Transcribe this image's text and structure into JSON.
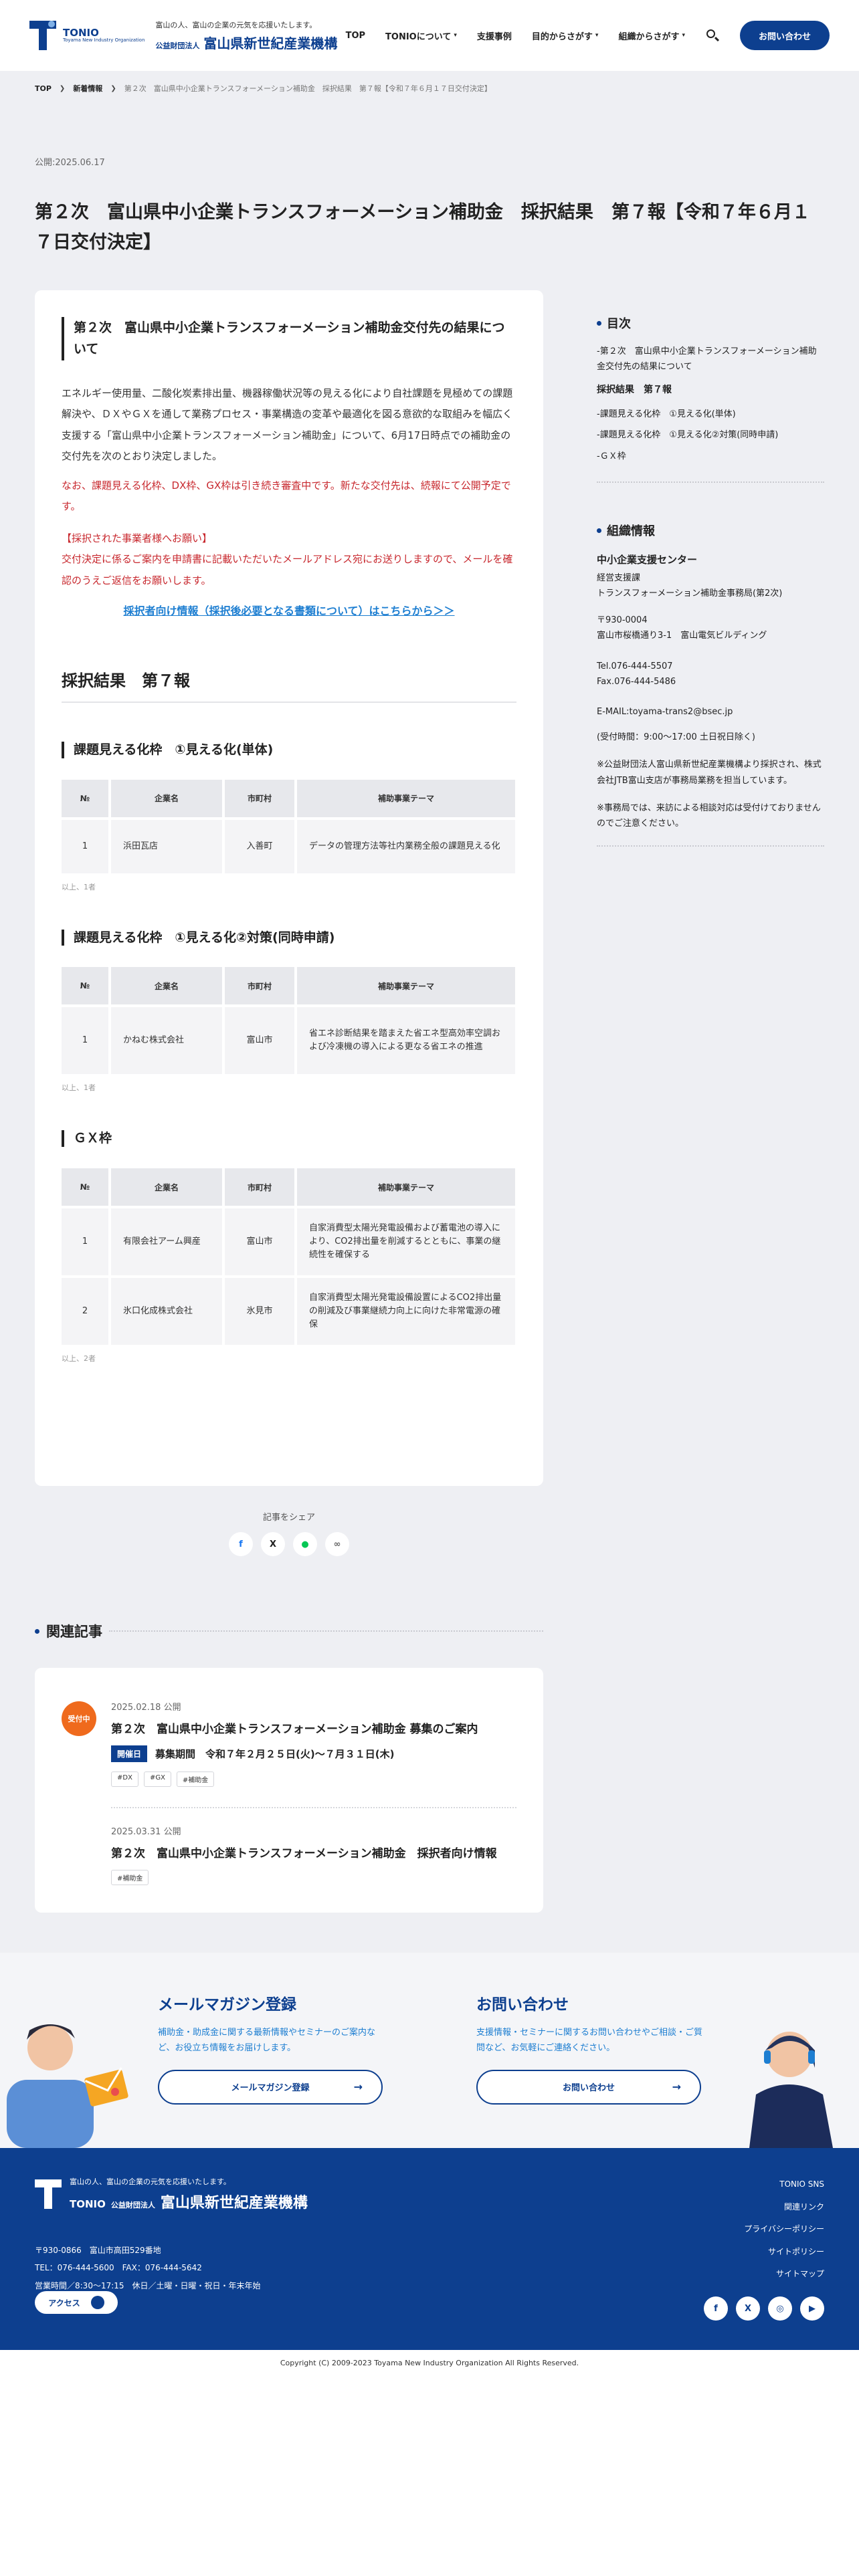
{
  "header": {
    "logo_en": "TONIO",
    "logo_en_sub": "Toyama New Industry Organization",
    "tagline": "富山の人、富山の企業の元気を応援いたします。",
    "org_small": "公益財団法人",
    "org_name": "富山県新世紀産業機構",
    "nav": [
      "TOP",
      "TONIOについて",
      "支援事例",
      "目的からさがす",
      "組織からさがす"
    ],
    "contact_label": "お問い合わせ"
  },
  "breadcrumb": [
    "TOP",
    "新着情報",
    "第２次　富山県中小企業トランスフォーメーション補助金　採択結果　第７報【令和７年６月１７日交付決定】"
  ],
  "post": {
    "date": "公開:2025.06.17",
    "title": "第２次　富山県中小企業トランスフォーメーション補助金　採択結果　第７報【令和７年６月１７日交付決定】"
  },
  "article": {
    "heading": "第２次　富山県中小企業トランスフォーメーション補助金交付先の結果について",
    "lead": "エネルギー使用量、二酸化炭素排出量、機器稼働状況等の見える化により自社課題を見極めての課題解決や、ＤＸやＧＸを通して業務プロセス・事業構造の変革や最適化を図る意欲的な取組みを幅広く支援する「富山県中小企業トランスフォーメーション補助金」について、6月17日時点での補助金の交付先を次のとおり決定しました。",
    "red_note": "なお、課題見える化枠、DX枠、GX枠は引き続き審査中です。新たな交付先は、続報にて公開予定です。",
    "notice_title": "【採択された事業者様へお願い】",
    "notice_body": "交付決定に係るご案内を申請書に記載いただいたメールアドレス宛にお送りしますので、メールを確認のうえご返信をお願いします。",
    "link_text": "採択者向け情報（採択後必要となる書類について）はこちらから＞＞",
    "section_title": "採択結果　第７報",
    "headers": [
      "№",
      "企業名",
      "市町村",
      "補助事業テーマ"
    ],
    "categories": [
      {
        "title": "課題見える化枠　①見える化(単体)",
        "rows": [
          {
            "no": "1",
            "company": "浜田瓦店",
            "city": "入善町",
            "theme": "データの管理方法等社内業務全般の課題見える化"
          }
        ],
        "count": "以上、1者"
      },
      {
        "title": "課題見える化枠　①見える化②対策(同時申請)",
        "rows": [
          {
            "no": "1",
            "company": "かねむ株式会社",
            "city": "富山市",
            "theme": "省エネ診断結果を踏まえた省エネ型高効率空調および冷凍機の導入による更なる省エネの推進"
          }
        ],
        "count": "以上、1者"
      },
      {
        "title": "ＧＸ枠",
        "rows": [
          {
            "no": "1",
            "company": "有限会社アーム興産",
            "city": "富山市",
            "theme": "自家消費型太陽光発電設備および蓄電池の導入により、CO2排出量を削減するとともに、事業の継続性を確保する"
          },
          {
            "no": "2",
            "company": "氷口化成株式会社",
            "city": "氷見市",
            "theme": "自家消費型太陽光発電設備設置によるCO2排出量の削減及び事業継続力向上に向けた非常電源の確保"
          }
        ],
        "count": "以上、2者"
      }
    ]
  },
  "share": {
    "label": "記事をシェア",
    "icons": [
      "facebook-icon",
      "x-icon",
      "line-icon",
      "link-icon"
    ]
  },
  "toc": {
    "title": "目次",
    "items": [
      "-第２次　富山県中小企業トランスフォーメーション補助金交付先の結果について",
      "採択結果　第７報",
      "-課題見える化枠　①見える化(単体)",
      "-課題見える化枠　①見える化②対策(同時申請)",
      "-ＧＸ枠"
    ]
  },
  "org_info": {
    "title": "組織情報",
    "name": "中小企業支援センター",
    "dept": "経営支援課",
    "office": "トランスフォーメーション補助金事務局(第2次)",
    "zip": "〒930-0004",
    "address": "富山市桜橋通り3-1　富山電気ビルディング",
    "tel": "Tel.076-444-5507",
    "fax": "Fax.076-444-5486",
    "email": "E-MAIL:toyama-trans2@bsec.jp",
    "hours": "(受付時間：9:00〜17:00 土日祝日除く)",
    "note1": "※公益財団法人富山県新世紀産業機構より採択され、株式会社JTB富山支店が事務局業務を担当しています。",
    "note2": "※事務局では、来訪による相談対応は受付けておりませんのでご注意ください。"
  },
  "related": {
    "title": "関連記事",
    "badge": "受付中",
    "items": [
      {
        "date": "2025.02.18 公開",
        "title": "第２次　富山県中小企業トランスフォーメーション補助金 募集のご案内",
        "status": "開催日",
        "period": "募集期間　令和７年２月２５日(火)〜７月３１日(木)",
        "tags": [
          "#DX",
          "#GX",
          "#補助金"
        ]
      },
      {
        "date": "2025.03.31 公開",
        "title": "第２次　富山県中小企業トランスフォーメーション補助金　採択者向け情報",
        "tags": [
          "#補助金"
        ]
      }
    ]
  },
  "band": {
    "mail_title": "メールマガジン登録",
    "mail_desc": "補助金・助成金に関する最新情報やセミナーのご案内など、お役立ち情報をお届けします。",
    "mail_btn": "メールマガジン登録",
    "contact_title": "お問い合わせ",
    "contact_desc": "支援情報・セミナーに関するお問い合わせやご相談・ご質問など、お気軽にご連絡ください。",
    "contact_btn": "お問い合わせ"
  },
  "footer": {
    "tagline": "富山の人、富山の企業の元気を応援いたします。",
    "logo_en": "TONIO",
    "org_small": "公益財団法人",
    "org_name": "富山県新世紀産業機構",
    "address": "〒930-0866　富山市高田529番地",
    "tel": "TEL：076-444-5600　FAX：076-444-5642",
    "hours": "営業時間／8:30〜17:15　休日／土曜・日曜・祝日・年末年始",
    "access": "アクセス",
    "links": [
      "TONIO SNS",
      "関連リンク",
      "プライバシーポリシー",
      "サイトポリシー",
      "サイトマップ"
    ],
    "social": [
      "f",
      "X",
      "◎",
      "▶"
    ],
    "copyright": "Copyright (C) 2009-2023 Toyama New Industry Organization All Rights Reserved."
  }
}
